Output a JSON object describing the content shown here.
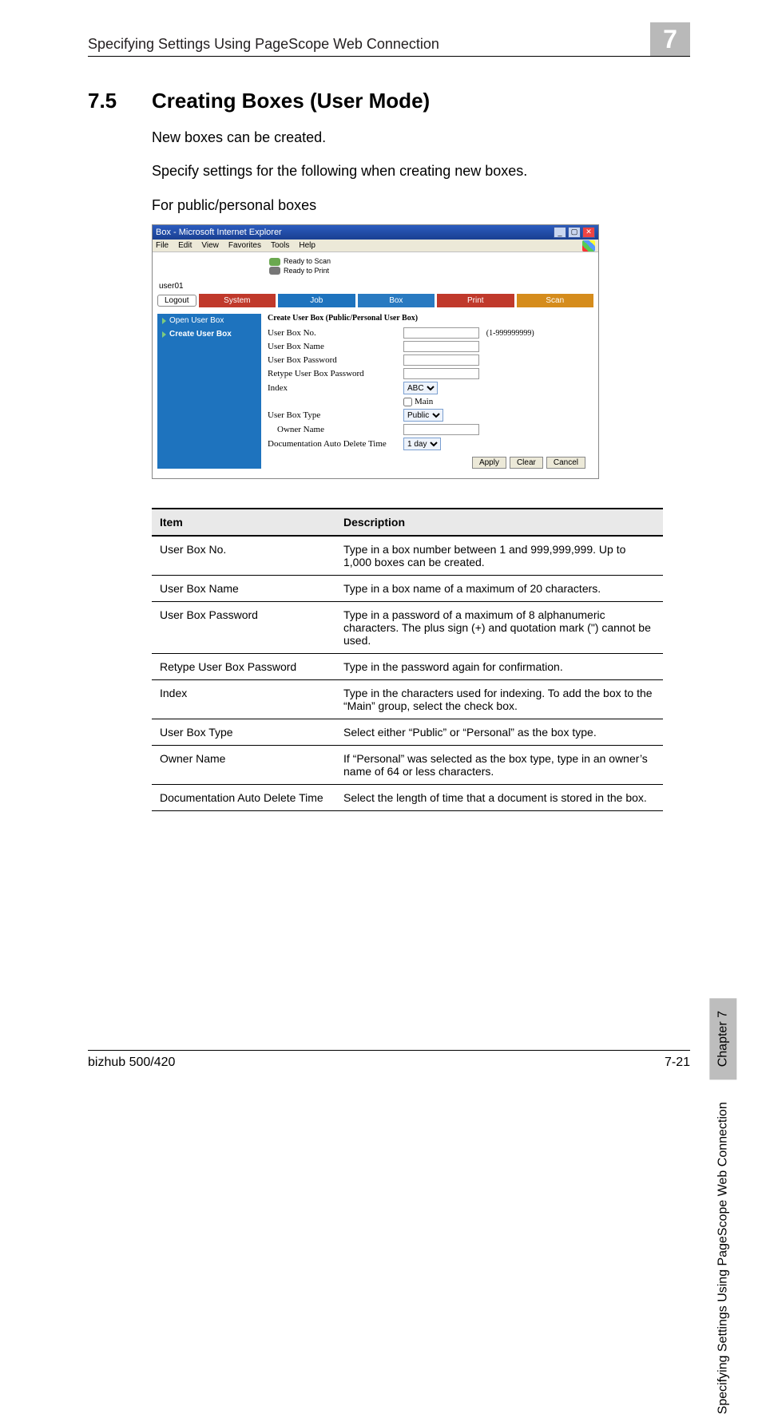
{
  "header": {
    "title": "Specifying Settings Using PageScope Web Connection",
    "chapter_digit": "7"
  },
  "section": {
    "num": "7.5",
    "title": "Creating Boxes (User Mode)"
  },
  "paragraphs": {
    "p1": "New boxes can be created.",
    "p2": "Specify settings for the following when creating new boxes.",
    "p3": "For public/personal boxes"
  },
  "side": {
    "running_title": "Specifying Settings Using PageScope Web Connection",
    "chapter_label": "Chapter 7"
  },
  "footer": {
    "left": "bizhub 500/420",
    "right": "7-21"
  },
  "browser": {
    "window_title": "Box - Microsoft Internet Explorer",
    "menus": [
      "File",
      "Edit",
      "View",
      "Favorites",
      "Tools",
      "Help"
    ],
    "status": {
      "scan": "Ready to Scan",
      "print": "Ready to Print"
    },
    "user": "user01",
    "logout": "Logout",
    "tabs": {
      "system": "System",
      "job": "Job",
      "box": "Box",
      "print": "Print",
      "scan": "Scan"
    },
    "left_nav": {
      "open": "Open User Box",
      "create": "Create User Box"
    },
    "form": {
      "title": "Create User Box (Public/Personal User Box)",
      "no_label": "User Box No.",
      "no_hint": "(1-999999999)",
      "name_label": "User Box Name",
      "pwd_label": "User Box Password",
      "repwd_label": "Retype User Box Password",
      "index_label": "Index",
      "index_value": "ABC",
      "main_checkbox": "Main",
      "type_label": "User Box Type",
      "type_value": "Public",
      "owner_label": "Owner Name",
      "deltime_label": "Documentation Auto Delete Time",
      "deltime_value": "1 day",
      "btn_apply": "Apply",
      "btn_clear": "Clear",
      "btn_cancel": "Cancel"
    }
  },
  "table": {
    "head_item": "Item",
    "head_desc": "Description",
    "rows": [
      {
        "item": "User Box No.",
        "desc": "Type in a box number between 1 and 999,999,999. Up to 1,000 boxes can be created."
      },
      {
        "item": "User Box Name",
        "desc": "Type in a box name of a maximum of 20 characters."
      },
      {
        "item": "User Box Password",
        "desc": "Type in a password of a maximum of 8 alphanumeric characters. The plus sign (+) and quotation mark (\") cannot be used."
      },
      {
        "item": "Retype User Box Password",
        "desc": "Type in the password again for confirmation."
      },
      {
        "item": "Index",
        "desc": "Type in the characters used for indexing. To add the box to the “Main” group, select the check box."
      },
      {
        "item": "User Box Type",
        "desc": "Select either “Public” or “Personal” as the box type."
      },
      {
        "item": "Owner Name",
        "desc": "If “Personal” was selected as the box type, type in an owner’s name of 64 or less characters."
      },
      {
        "item": "Documentation Auto Delete Time",
        "desc": "Select the length of time that a document is stored in the box."
      }
    ]
  }
}
